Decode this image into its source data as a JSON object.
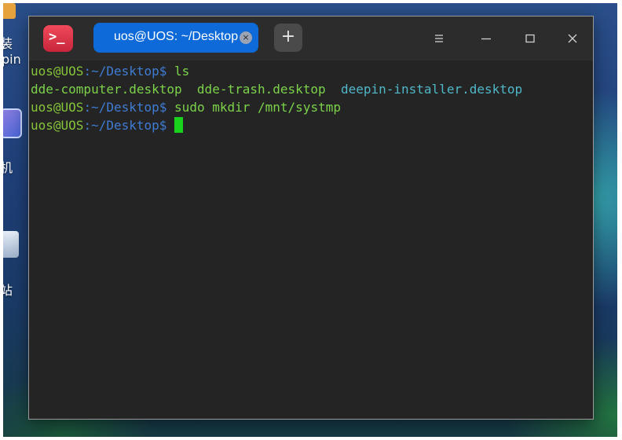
{
  "desktop": {
    "labels": [
      "装",
      "pin",
      "机",
      "站"
    ]
  },
  "window": {
    "app_icon_glyph": ">_",
    "tab_label": "uos@UOS: ~/Desktop",
    "tab_close_glyph": "×",
    "new_tab_glyph": "+"
  },
  "terminal": {
    "prompt_user": "uos@UOS",
    "prompt_path": ":~/Desktop$",
    "lines": [
      {
        "command": "ls"
      },
      {
        "files": [
          "dde-computer.desktop",
          "dde-trash.desktop",
          "deepin-installer.desktop"
        ]
      },
      {
        "command": "sudo mkdir /mnt/systmp"
      },
      {
        "command": ""
      }
    ]
  },
  "colors": {
    "accent": "#0d6ad8",
    "prompt_user": "#86c53a",
    "prompt_path": "#3f7cd3",
    "cursor": "#18d21c"
  }
}
